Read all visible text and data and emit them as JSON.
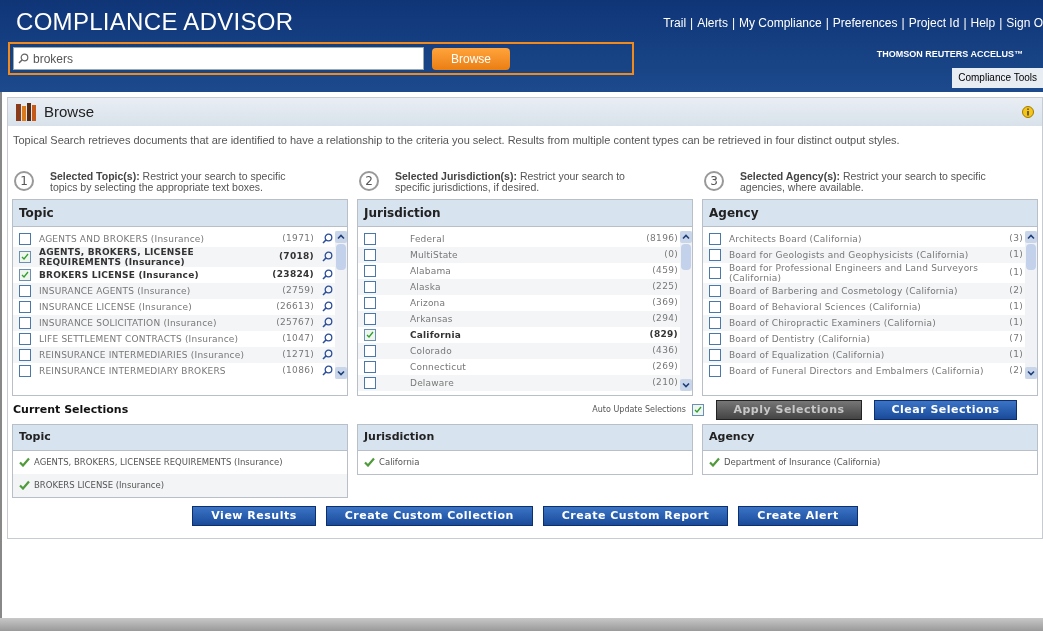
{
  "header": {
    "title": "COMPLIANCE ADVISOR",
    "nav": [
      {
        "kind": "link",
        "text": "Trail"
      },
      {
        "kind": "separator",
        "text": "|"
      },
      {
        "kind": "link",
        "text": "Alerts"
      },
      {
        "kind": "separator",
        "text": "|"
      },
      {
        "kind": "link",
        "text": "My Compliance"
      },
      {
        "kind": "separator",
        "text": "|"
      },
      {
        "kind": "link",
        "text": "Preferences"
      },
      {
        "kind": "separator",
        "text": "|"
      },
      {
        "kind": "link",
        "text": "Project Id"
      },
      {
        "kind": "separator",
        "text": "|"
      },
      {
        "kind": "link",
        "text": "Help"
      },
      {
        "kind": "separator",
        "text": "|"
      },
      {
        "kind": "link",
        "text": "Sign O"
      }
    ],
    "search": {
      "value": "brokers"
    },
    "search_button": "Browse",
    "brand": "THOMSON REUTERS ACCELUS™",
    "tabs": [
      {
        "label": "Compliance Tools",
        "selected": true
      }
    ]
  },
  "panel": {
    "title": "Browse",
    "description": "Topical Search retrieves documents that are identified to have a relationship to the criteria you select.  Results from multiple content types can be retrieved in four distinct output styles.",
    "steps": [
      {
        "number": "1",
        "label": "Selected Topic(s):",
        "text": "Restrict your search to specific topics by selecting the appropriate text boxes.",
        "list_title": "Topic",
        "searchable": true,
        "items": [
          {
            "name": "AGENTS AND BROKERS (Insurance)",
            "count": "(1971)",
            "checked": false
          },
          {
            "name": "AGENTS, BROKERS, LICENSEE REQUIREMENTS (Insurance)",
            "count": "(7018)",
            "checked": true
          },
          {
            "name": "BROKERS LICENSE (Insurance)",
            "count": "(23824)",
            "checked": true
          },
          {
            "name": "INSURANCE AGENTS (Insurance)",
            "count": "(2759)",
            "checked": false
          },
          {
            "name": "INSURANCE LICENSE (Insurance)",
            "count": "(26613)",
            "checked": false
          },
          {
            "name": "INSURANCE SOLICITATION (Insurance)",
            "count": "(25767)",
            "checked": false
          },
          {
            "name": "LIFE SETTLEMENT CONTRACTS (Insurance)",
            "count": "(1047)",
            "checked": false
          },
          {
            "name": "REINSURANCE INTERMEDIARIES (Insurance)",
            "count": "(1271)",
            "checked": false
          },
          {
            "name": "REINSURANCE INTERMEDIARY BROKERS",
            "count": "(1086)",
            "checked": false
          }
        ]
      },
      {
        "number": "2",
        "label": "Selected Jurisdiction(s):",
        "text": "Restrict your search to specific jurisdictions, if desired.",
        "list_title": "Jurisdiction",
        "searchable": false,
        "items": [
          {
            "name": "Federal",
            "count": "(8196)",
            "checked": false
          },
          {
            "name": "MultiState",
            "count": "(0)",
            "checked": false
          },
          {
            "name": "Alabama",
            "count": "(459)",
            "checked": false
          },
          {
            "name": "Alaska",
            "count": "(225)",
            "checked": false
          },
          {
            "name": "Arizona",
            "count": "(369)",
            "checked": false
          },
          {
            "name": "Arkansas",
            "count": "(294)",
            "checked": false
          },
          {
            "name": "California",
            "count": "(829)",
            "checked": true
          },
          {
            "name": "Colorado",
            "count": "(436)",
            "checked": false
          },
          {
            "name": "Connecticut",
            "count": "(269)",
            "checked": false
          },
          {
            "name": "Delaware",
            "count": "(210)",
            "checked": false
          }
        ]
      },
      {
        "number": "3",
        "label": "Selected Agency(s):",
        "text": "Restrict your search to specific agencies, where available.",
        "list_title": "Agency",
        "searchable": false,
        "items": [
          {
            "name": "Architects Board (California)",
            "count": "(3)",
            "checked": false
          },
          {
            "name": "Board for Geologists and Geophysicists (California)",
            "count": "(1)",
            "checked": false
          },
          {
            "name": "Board for Professional   Engineers and Land Surveyors (California)",
            "count": "(1)",
            "checked": false
          },
          {
            "name": "Board of Barbering and Cosmetology (California)",
            "count": "(2)",
            "checked": false
          },
          {
            "name": "Board of Behavioral Sciences (California)",
            "count": "(1)",
            "checked": false
          },
          {
            "name": "Board of Chiropractic Examiners (California)",
            "count": "(1)",
            "checked": false
          },
          {
            "name": "Board of Dentistry (California)",
            "count": "(7)",
            "checked": false
          },
          {
            "name": "Board of Equalization (California)",
            "count": "(1)",
            "checked": false
          },
          {
            "name": "Board of Funeral Directors and Embalmers (California)",
            "count": "(2)",
            "checked": false
          }
        ]
      }
    ],
    "current_selections": {
      "title": "Current Selections",
      "auto_update": {
        "label": "Auto Update Selections",
        "checked": true
      },
      "apply_button": {
        "label": "Apply Selections",
        "disabled": true
      },
      "clear_button": "Clear Selections",
      "groups": [
        {
          "title": "Topic",
          "items": [
            "AGENTS, BROKERS, LICENSEE REQUIREMENTS (Insurance)",
            "BROKERS LICENSE (Insurance)"
          ]
        },
        {
          "title": "Jurisdiction",
          "items": [
            "California"
          ]
        },
        {
          "title": "Agency",
          "items": [
            "Department of Insurance (California)"
          ]
        }
      ]
    },
    "actions": [
      "View Results",
      "Create Custom Collection",
      "Create Custom Report",
      "Create Alert"
    ]
  }
}
